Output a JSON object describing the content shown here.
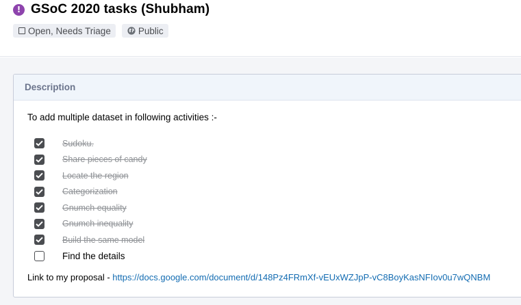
{
  "header": {
    "title": "GSoC 2020 tasks (Shubham)",
    "status_icon": "exclamation-circle-icon",
    "status_color": "#8e44ad",
    "tags": [
      {
        "label": "Open, Needs Triage",
        "icon": "square-icon"
      },
      {
        "label": "Public",
        "icon": "globe-icon"
      }
    ]
  },
  "description": {
    "heading": "Description",
    "intro": "To add multiple dataset in following activities :-",
    "tasks": [
      {
        "label": "Sudoku.",
        "checked": true
      },
      {
        "label": "Share pieces of candy",
        "checked": true
      },
      {
        "label": "Locate the region",
        "checked": true
      },
      {
        "label": "Categorization",
        "checked": true
      },
      {
        "label": "Gnumch equality",
        "checked": true
      },
      {
        "label": "Gnumch inequality",
        "checked": true
      },
      {
        "label": "Build the same model",
        "checked": true
      },
      {
        "label": "Find the details",
        "checked": false
      }
    ],
    "proposal_prefix": "Link to my proposal - ",
    "proposal_link": "https://docs.google.com/document/d/148Pz4FRmXf-vEUxWZJpP-vC8BoyKasNFIov0u7wQNBM"
  },
  "colors": {
    "link": "#136cb2",
    "panel_heading": "#6b748c",
    "checkbox": "#4b4d51"
  }
}
